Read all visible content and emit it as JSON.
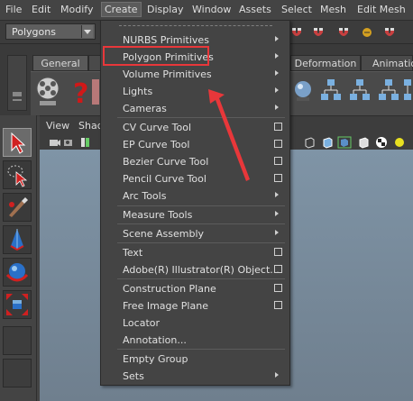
{
  "menubar": {
    "items": [
      "File",
      "Edit",
      "Modify",
      "Create",
      "Display",
      "Window",
      "Assets",
      "Select",
      "Mesh",
      "Edit Mesh"
    ],
    "active": "Create"
  },
  "mode_row": {
    "menu_set": "Polygons"
  },
  "shelf": {
    "tabs": [
      "General",
      "Deformation",
      "Animation"
    ],
    "active_tab": "General"
  },
  "panel": {
    "menu_items": [
      "View",
      "Shad"
    ]
  },
  "create_menu": {
    "items": [
      {
        "label": "NURBS Primitives",
        "submenu": true
      },
      {
        "label": "Polygon Primitives",
        "submenu": true,
        "highlighted": true
      },
      {
        "label": "Volume Primitives",
        "submenu": true
      },
      {
        "label": "Lights",
        "submenu": true
      },
      {
        "label": "Cameras",
        "submenu": true
      },
      {
        "label": "CV Curve Tool",
        "option_box": true
      },
      {
        "label": "EP Curve Tool",
        "option_box": true
      },
      {
        "label": "Bezier Curve Tool",
        "option_box": true
      },
      {
        "label": "Pencil Curve Tool",
        "option_box": true
      },
      {
        "label": "Arc Tools",
        "submenu": true
      },
      {
        "label": "Measure Tools",
        "submenu": true
      },
      {
        "label": "Scene Assembly",
        "submenu": true
      },
      {
        "label": "Text",
        "option_box": true
      },
      {
        "label": "Adobe(R) Illustrator(R) Object...",
        "option_box": true
      },
      {
        "label": "Construction Plane",
        "option_box": true
      },
      {
        "label": "Free Image Plane",
        "option_box": true
      },
      {
        "label": "Locator"
      },
      {
        "label": "Annotation..."
      },
      {
        "label": "Empty Group"
      },
      {
        "label": "Sets",
        "submenu": true
      }
    ]
  },
  "annotation": {
    "box_color": "#e8373a",
    "arrow_color": "#e8373a"
  },
  "icons": [
    "select-tool-icon",
    "lasso-tool-icon",
    "paint-tool-icon",
    "move-tool-icon",
    "rotate-tool-icon",
    "scale-tool-icon",
    "render-icon",
    "help-icon"
  ]
}
